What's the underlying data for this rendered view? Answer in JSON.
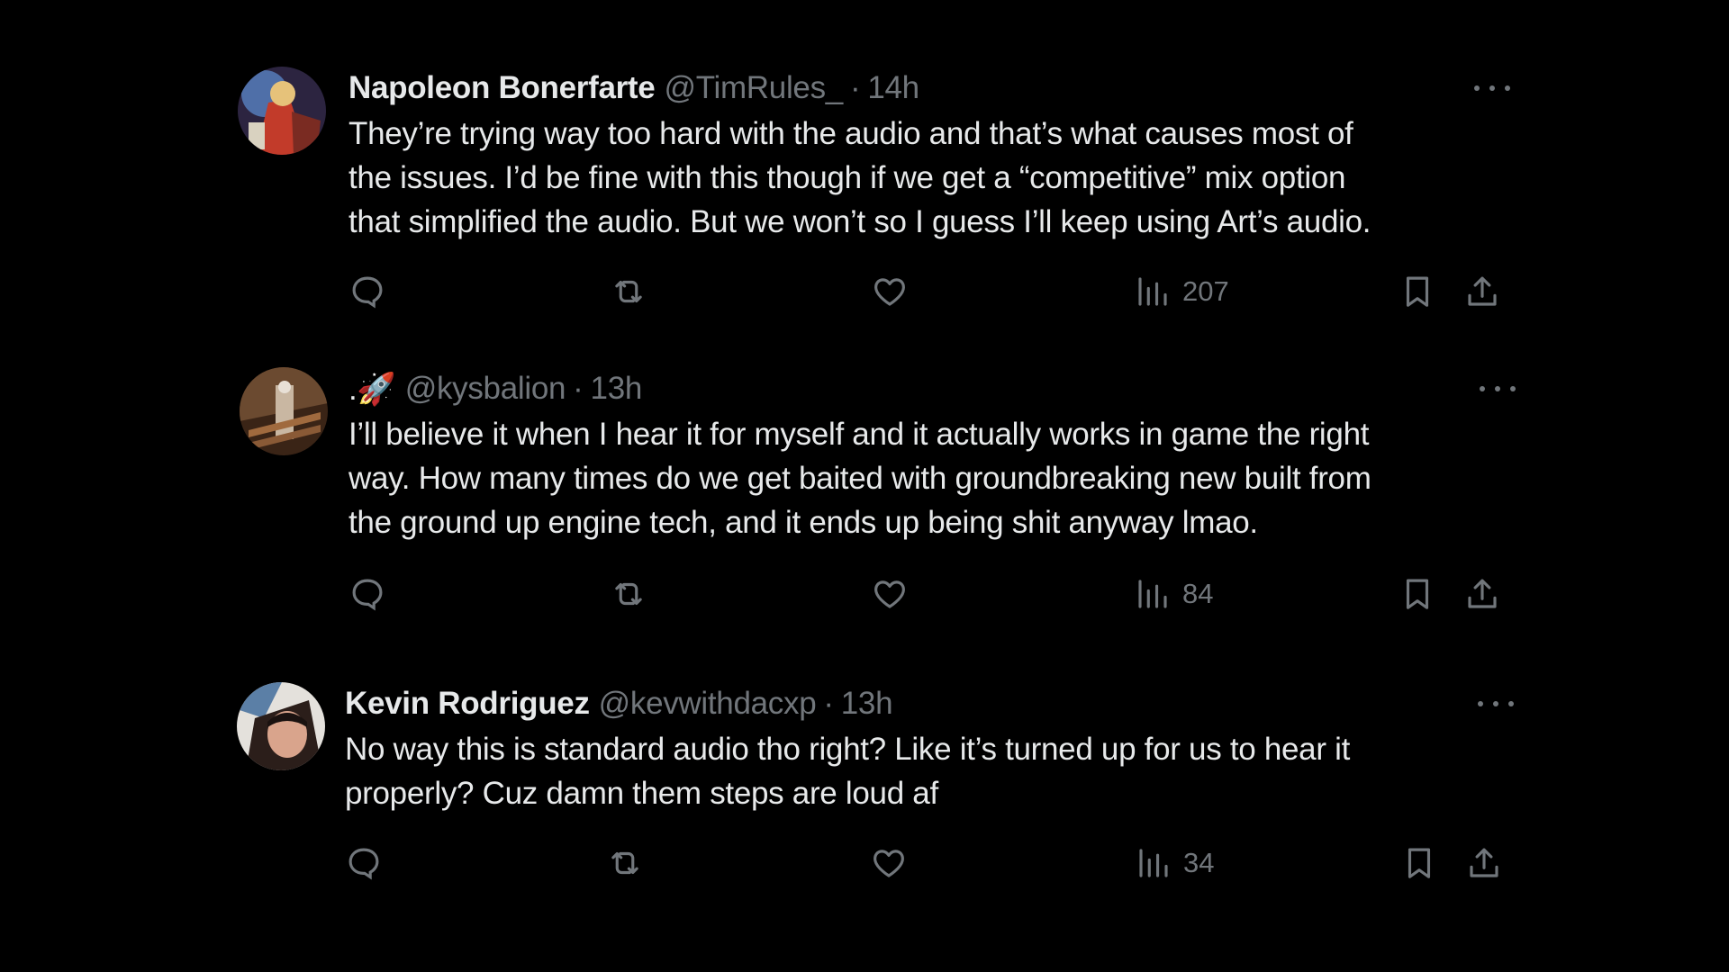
{
  "tweets": [
    {
      "display_name": "Napoleon Bonerfarte",
      "handle": "@TimRules_",
      "separator": "·",
      "time": "14h",
      "lines": [
        "They’re trying way too hard with the audio and that’s what causes most of",
        "the issues. I’d be fine with this though if we get a “competitive” mix option",
        "that simplified the audio. But we won’t so I guess I’ll keep using Art’s audio."
      ],
      "views": "207",
      "avatar_colors": [
        "#3a2a5a",
        "#c23b2a",
        "#e6c27a"
      ]
    },
    {
      "display_name": ".🚀",
      "handle": "@kysbalion",
      "separator": "·",
      "time": "13h",
      "lines": [
        "I’ll believe it when I hear it for myself and it actually works in game the right",
        "way. How many times do we get baited with groundbreaking new built from",
        "the ground up engine tech, and it ends up being shit anyway lmao."
      ],
      "views": "84",
      "avatar_colors": [
        "#4a2e1c",
        "#8a5a36",
        "#c9b7a2"
      ]
    },
    {
      "display_name": "Kevin Rodriguez",
      "handle": "@kevwithdacxp",
      "separator": "·",
      "time": "13h",
      "lines": [
        "No way this is standard audio tho right? Like it’s turned up for us to hear it",
        "properly? Cuz damn them steps are loud af"
      ],
      "views": "34",
      "avatar_colors": [
        "#5b7fa6",
        "#2b1e1a",
        "#d9a48c"
      ]
    }
  ],
  "icons": {
    "reply": "reply-icon",
    "retweet": "retweet-icon",
    "like": "heart-icon",
    "views": "views-icon",
    "bookmark": "bookmark-icon",
    "share": "share-icon",
    "more": "more-icon"
  },
  "colors": {
    "background": "#000000",
    "text": "#e7e9ea",
    "secondary": "#71767b"
  }
}
